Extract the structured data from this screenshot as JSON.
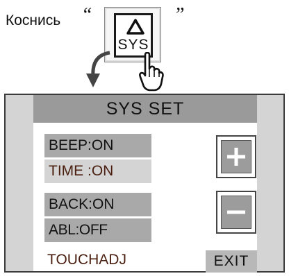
{
  "instruction": {
    "label": "Коснись",
    "quote_open": "“",
    "quote_close": "”",
    "key_label": "SYS",
    "icons": [
      "triangle-up-icon",
      "pointing-hand-icon",
      "down-arrow-icon"
    ]
  },
  "panel": {
    "title": "SYS SET",
    "menu": [
      {
        "label": "BEEP:ON"
      },
      {
        "label": "TIME :ON"
      },
      {
        "label": "BACK:ON"
      },
      {
        "label": "ABL:OFF"
      }
    ],
    "touchadj_label": "TOUCHADJ",
    "exit_label": "EXIT",
    "plus_icon": "plus-icon",
    "minus_icon": "minus-icon"
  },
  "colors": {
    "panel_bg": "#d4d4d4",
    "title_bar": "#9a9a9a",
    "menu_dark": "#a9a9a9",
    "menu_light": "#d4d4d4",
    "accent_text": "#4a1f10"
  }
}
